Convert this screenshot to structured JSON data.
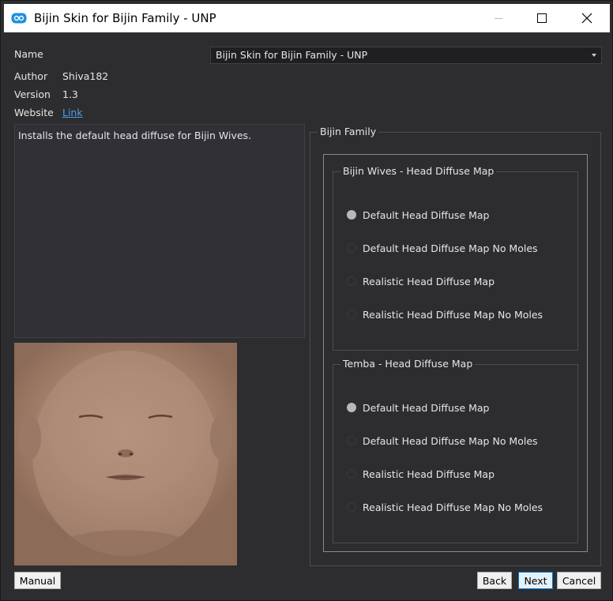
{
  "window": {
    "title": "Bijin Skin for Bijin Family - UNP"
  },
  "info": {
    "name_label": "Name",
    "name_value": "Bijin Skin for Bijin Family - UNP",
    "author_label": "Author",
    "author_value": "Shiva182",
    "version_label": "Version",
    "version_value": "1.3",
    "website_label": "Website",
    "website_link": "Link"
  },
  "description": "Installs the default head diffuse for Bijin Wives.",
  "group": {
    "title": "Bijin Family",
    "sections": [
      {
        "title": "Bijin Wives - Head Diffuse Map",
        "options": [
          {
            "label": "Default Head Diffuse Map",
            "selected": true
          },
          {
            "label": "Default Head Diffuse Map No Moles",
            "selected": false
          },
          {
            "label": "Realistic Head Diffuse Map",
            "selected": false
          },
          {
            "label": "Realistic Head Diffuse Map No Moles",
            "selected": false
          }
        ]
      },
      {
        "title": "Temba - Head Diffuse Map",
        "options": [
          {
            "label": "Default Head Diffuse Map",
            "selected": true
          },
          {
            "label": "Default Head Diffuse Map No Moles",
            "selected": false
          },
          {
            "label": "Realistic Head Diffuse Map",
            "selected": false
          },
          {
            "label": "Realistic Head Diffuse Map No Moles",
            "selected": false
          }
        ]
      }
    ]
  },
  "buttons": {
    "manual": "Manual",
    "back": "Back",
    "next": "Next",
    "cancel": "Cancel"
  },
  "colors": {
    "background": "#2d2d30",
    "link": "#4a9ee8",
    "focus": "#0078d7"
  }
}
